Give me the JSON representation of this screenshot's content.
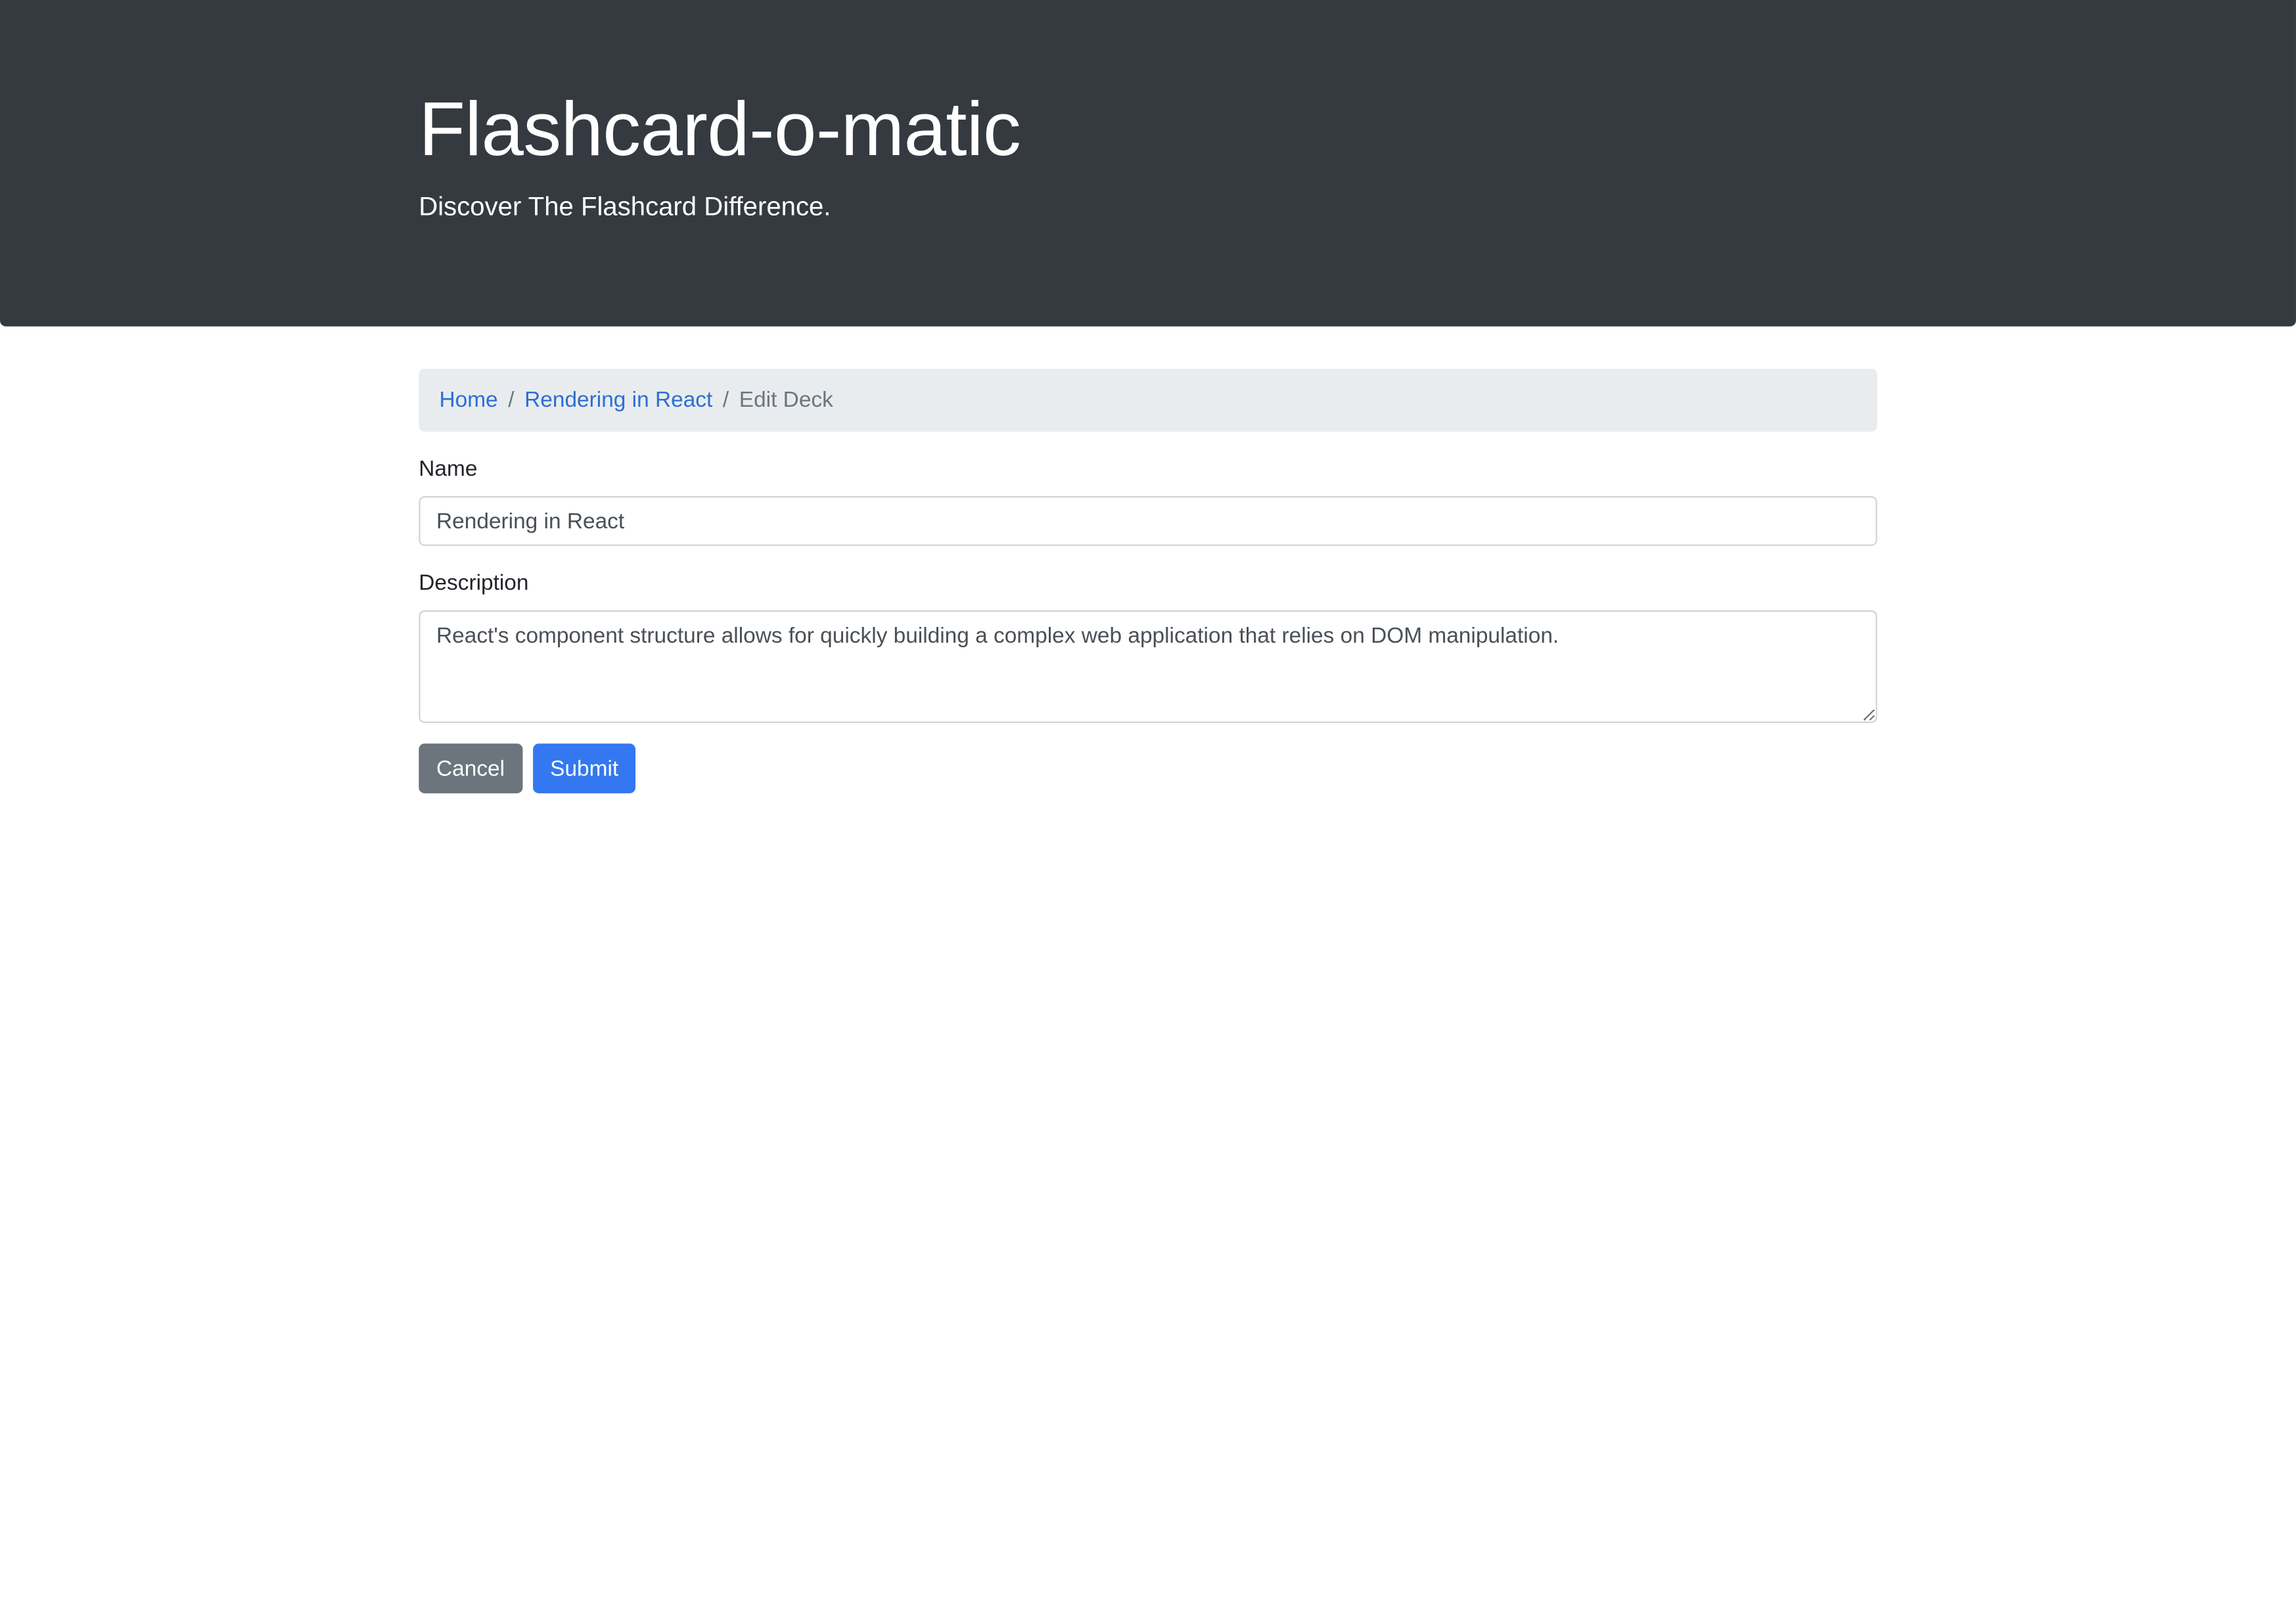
{
  "header": {
    "title": "Flashcard-o-matic",
    "subtitle": "Discover The Flashcard Difference."
  },
  "breadcrumb": {
    "items": [
      {
        "label": "Home",
        "link": true
      },
      {
        "label": "Rendering in React",
        "link": true
      },
      {
        "label": "Edit Deck",
        "link": false
      }
    ],
    "separator": "/"
  },
  "form": {
    "name_label": "Name",
    "name_value": "Rendering in React",
    "description_label": "Description",
    "description_value": "React's component structure allows for quickly building a complex web application that relies on DOM manipulation.",
    "cancel_label": "Cancel",
    "submit_label": "Submit"
  },
  "colors": {
    "header_bg": "#343a40",
    "link": "#2b6fd4",
    "primary": "#3378f0",
    "secondary": "#6c757d"
  }
}
